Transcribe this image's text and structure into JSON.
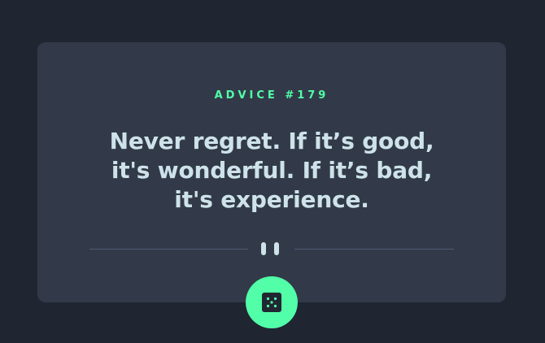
{
  "advice": {
    "id_label": "ADVICE #179",
    "text": "Never regret. If it’s good, it's wonderful. If it’s bad, it's experience."
  },
  "colors": {
    "background": "#1f2632",
    "card": "#323a49",
    "accent": "#52ffa8",
    "text": "#cee3e9",
    "divider": "#4f5d74"
  },
  "icons": {
    "divider": "pause-icon",
    "button": "dice-icon"
  }
}
